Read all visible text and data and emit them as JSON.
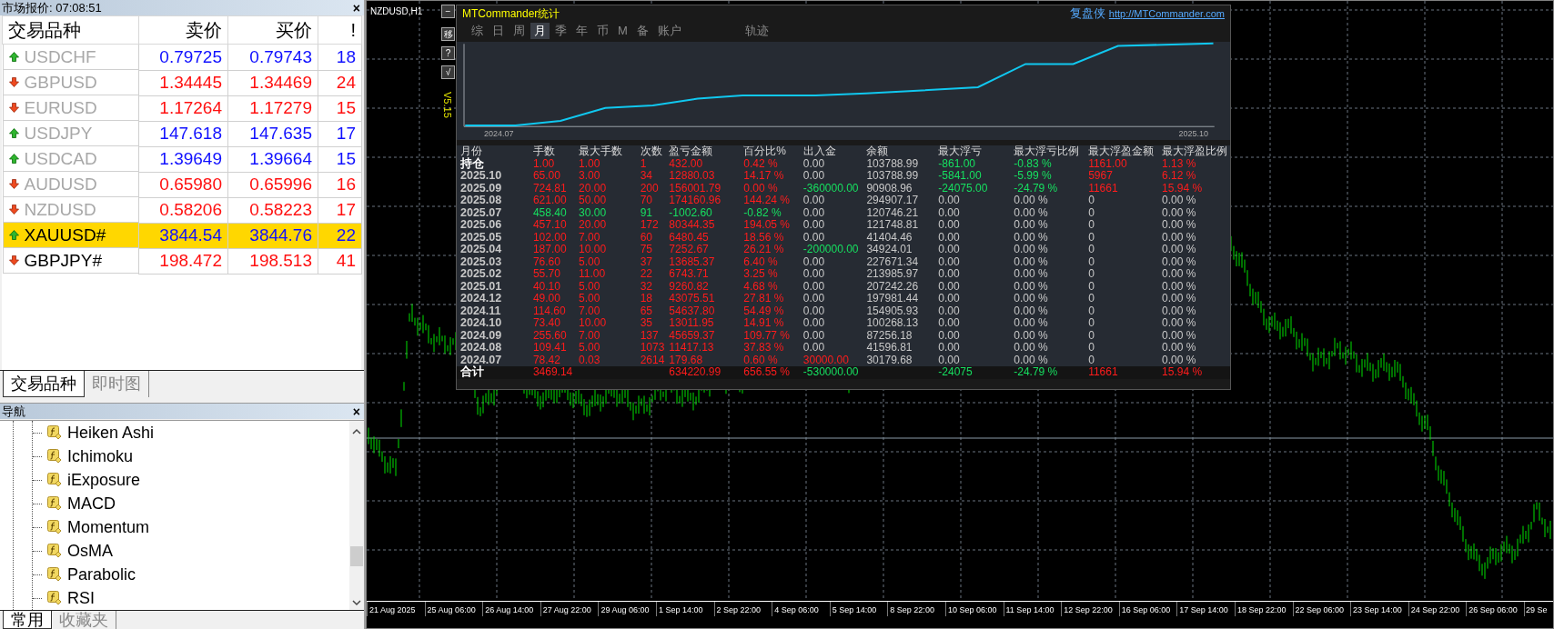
{
  "market_watch": {
    "title": "市场报价: 07:08:51",
    "close": "×",
    "columns": [
      "交易品种",
      "卖价",
      "买价",
      "!"
    ],
    "rows": [
      {
        "symbol": "USDCHF",
        "bid": "0.79725",
        "ask": "0.79743",
        "spread": "18",
        "rising": true,
        "dimmed": true,
        "selected": false
      },
      {
        "symbol": "GBPUSD",
        "bid": "1.34445",
        "ask": "1.34469",
        "spread": "24",
        "rising": false,
        "dimmed": true,
        "selected": false
      },
      {
        "symbol": "EURUSD",
        "bid": "1.17264",
        "ask": "1.17279",
        "spread": "15",
        "rising": false,
        "dimmed": true,
        "selected": false
      },
      {
        "symbol": "USDJPY",
        "bid": "147.618",
        "ask": "147.635",
        "spread": "17",
        "rising": true,
        "dimmed": true,
        "selected": false
      },
      {
        "symbol": "USDCAD",
        "bid": "1.39649",
        "ask": "1.39664",
        "spread": "15",
        "rising": true,
        "dimmed": true,
        "selected": false
      },
      {
        "symbol": "AUDUSD",
        "bid": "0.65980",
        "ask": "0.65996",
        "spread": "16",
        "rising": false,
        "dimmed": true,
        "selected": false
      },
      {
        "symbol": "NZDUSD",
        "bid": "0.58206",
        "ask": "0.58223",
        "spread": "17",
        "rising": false,
        "dimmed": true,
        "selected": false
      },
      {
        "symbol": "XAUUSD#",
        "bid": "3844.54",
        "ask": "3844.76",
        "spread": "22",
        "rising": true,
        "dimmed": false,
        "selected": true
      },
      {
        "symbol": "GBPJPY#",
        "bid": "198.472",
        "ask": "198.513",
        "spread": "41",
        "rising": false,
        "dimmed": false,
        "selected": false
      }
    ],
    "tabs": [
      {
        "label": "交易品种",
        "selected": true
      },
      {
        "label": "即时图",
        "selected": false
      }
    ]
  },
  "navigator": {
    "title": "导航",
    "close": "×",
    "items": [
      "Heiken Ashi",
      "Ichimoku",
      "iExposure",
      "MACD",
      "Momentum",
      "OsMA",
      "Parabolic",
      "RSI"
    ],
    "tabs": [
      {
        "label": "常用",
        "selected": true
      },
      {
        "label": "收藏夹",
        "selected": false
      }
    ]
  },
  "chart": {
    "title": "NZDUSD,H1",
    "time_labels": [
      "21 Aug 2025",
      "25 Aug 06:00",
      "26 Aug 14:00",
      "27 Aug 22:00",
      "29 Aug 06:00",
      "1 Sep 14:00",
      "2 Sep 22:00",
      "4 Sep 06:00",
      "5 Sep 14:00",
      "8 Sep 22:00",
      "10 Sep 06:00",
      "11 Sep 14:00",
      "12 Sep 22:00",
      "16 Sep 06:00",
      "17 Sep 14:00",
      "18 Sep 22:00",
      "22 Sep 06:00",
      "23 Sep 14:00",
      "24 Sep 22:00",
      "26 Sep 06:00",
      "29 Se"
    ]
  },
  "stats_panel": {
    "side_buttons": [
      "−",
      "移",
      "?",
      "√"
    ],
    "title": "MTCommander统计",
    "brand": "复盘侠",
    "url": "http://MTCommander.com",
    "tabs": [
      {
        "label": "综",
        "selected": false
      },
      {
        "label": "日",
        "selected": false
      },
      {
        "label": "周",
        "selected": false
      },
      {
        "label": "月",
        "selected": true
      },
      {
        "label": "季",
        "selected": false
      },
      {
        "label": "年",
        "selected": false
      },
      {
        "label": "币",
        "selected": false
      },
      {
        "label": "M",
        "selected": false
      },
      {
        "label": "备",
        "selected": false
      },
      {
        "label": "账户",
        "selected": false
      },
      {
        "label": "轨迹",
        "selected": false
      }
    ],
    "version": "V5.15",
    "curve_start": "2024.07",
    "curve_end": "2025.10",
    "columns": [
      "月份",
      "手数",
      "最大手数",
      "次数",
      "盈亏金额",
      "百分比%",
      "出入金",
      "余额",
      "最大浮亏",
      "最大浮亏比例",
      "最大浮盈金额",
      "最大浮盈比例"
    ],
    "rows": [
      [
        {
          "text": "持仓",
          "color": "#ffffff"
        },
        {
          "text": "1.00",
          "color": "#ff1c1c"
        },
        {
          "text": "1.00",
          "color": "#ff1c1c"
        },
        {
          "text": "1",
          "color": "#ff1c1c"
        },
        {
          "text": "432.00",
          "color": "#ff1c1c"
        },
        {
          "text": "0.42 %",
          "color": "#ff1c1c"
        },
        {
          "text": "0.00",
          "color": "#c8c8c8"
        },
        {
          "text": "103788.99",
          "color": "#c8c8c8"
        },
        {
          "text": "-861.00",
          "color": "#16e060"
        },
        {
          "text": "-0.83 %",
          "color": "#16e060"
        },
        {
          "text": "1161.00",
          "color": "#ff1c1c"
        },
        {
          "text": "1.13 %",
          "color": "#ff1c1c"
        }
      ],
      [
        {
          "text": "2025.10",
          "color": "#c8c8c8"
        },
        {
          "text": "65.00",
          "color": "#ff1c1c"
        },
        {
          "text": "3.00",
          "color": "#ff1c1c"
        },
        {
          "text": "34",
          "color": "#ff1c1c"
        },
        {
          "text": "12880.03",
          "color": "#ff1c1c"
        },
        {
          "text": "14.17 %",
          "color": "#ff1c1c"
        },
        {
          "text": "0.00",
          "color": "#c8c8c8"
        },
        {
          "text": "103788.99",
          "color": "#c8c8c8"
        },
        {
          "text": "-5841.00",
          "color": "#16e060"
        },
        {
          "text": "-5.99 %",
          "color": "#16e060"
        },
        {
          "text": "5967",
          "color": "#ff1c1c"
        },
        {
          "text": "6.12 %",
          "color": "#ff1c1c"
        }
      ],
      [
        {
          "text": "2025.09",
          "color": "#c8c8c8"
        },
        {
          "text": "724.81",
          "color": "#ff1c1c"
        },
        {
          "text": "20.00",
          "color": "#ff1c1c"
        },
        {
          "text": "200",
          "color": "#ff1c1c"
        },
        {
          "text": "156001.79",
          "color": "#ff1c1c"
        },
        {
          "text": "0.00 %",
          "color": "#ff1c1c"
        },
        {
          "text": "-360000.00",
          "color": "#16e060"
        },
        {
          "text": "90908.96",
          "color": "#c8c8c8"
        },
        {
          "text": "-24075.00",
          "color": "#16e060"
        },
        {
          "text": "-24.79 %",
          "color": "#16e060"
        },
        {
          "text": "11661",
          "color": "#ff1c1c"
        },
        {
          "text": "15.94 %",
          "color": "#ff1c1c"
        }
      ],
      [
        {
          "text": "2025.08",
          "color": "#c8c8c8"
        },
        {
          "text": "621.00",
          "color": "#ff1c1c"
        },
        {
          "text": "50.00",
          "color": "#ff1c1c"
        },
        {
          "text": "70",
          "color": "#ff1c1c"
        },
        {
          "text": "174160.96",
          "color": "#ff1c1c"
        },
        {
          "text": "144.24 %",
          "color": "#ff1c1c"
        },
        {
          "text": "0.00",
          "color": "#c8c8c8"
        },
        {
          "text": "294907.17",
          "color": "#c8c8c8"
        },
        {
          "text": "0.00",
          "color": "#c8c8c8"
        },
        {
          "text": "0.00 %",
          "color": "#c8c8c8"
        },
        {
          "text": "0",
          "color": "#c8c8c8"
        },
        {
          "text": "0.00 %",
          "color": "#c8c8c8"
        }
      ],
      [
        {
          "text": "2025.07",
          "color": "#c8c8c8"
        },
        {
          "text": "458.40",
          "color": "#16e060"
        },
        {
          "text": "30.00",
          "color": "#16e060"
        },
        {
          "text": "91",
          "color": "#16e060"
        },
        {
          "text": "-1002.60",
          "color": "#16e060"
        },
        {
          "text": "-0.82 %",
          "color": "#16e060"
        },
        {
          "text": "0.00",
          "color": "#c8c8c8"
        },
        {
          "text": "120746.21",
          "color": "#c8c8c8"
        },
        {
          "text": "0.00",
          "color": "#c8c8c8"
        },
        {
          "text": "0.00 %",
          "color": "#c8c8c8"
        },
        {
          "text": "0",
          "color": "#c8c8c8"
        },
        {
          "text": "0.00 %",
          "color": "#c8c8c8"
        }
      ],
      [
        {
          "text": "2025.06",
          "color": "#c8c8c8"
        },
        {
          "text": "457.10",
          "color": "#ff1c1c"
        },
        {
          "text": "20.00",
          "color": "#ff1c1c"
        },
        {
          "text": "172",
          "color": "#ff1c1c"
        },
        {
          "text": "80344.35",
          "color": "#ff1c1c"
        },
        {
          "text": "194.05 %",
          "color": "#ff1c1c"
        },
        {
          "text": "0.00",
          "color": "#c8c8c8"
        },
        {
          "text": "121748.81",
          "color": "#c8c8c8"
        },
        {
          "text": "0.00",
          "color": "#c8c8c8"
        },
        {
          "text": "0.00 %",
          "color": "#c8c8c8"
        },
        {
          "text": "0",
          "color": "#c8c8c8"
        },
        {
          "text": "0.00 %",
          "color": "#c8c8c8"
        }
      ],
      [
        {
          "text": "2025.05",
          "color": "#c8c8c8"
        },
        {
          "text": "102.00",
          "color": "#ff1c1c"
        },
        {
          "text": "7.00",
          "color": "#ff1c1c"
        },
        {
          "text": "60",
          "color": "#ff1c1c"
        },
        {
          "text": "6480.45",
          "color": "#ff1c1c"
        },
        {
          "text": "18.56 %",
          "color": "#ff1c1c"
        },
        {
          "text": "0.00",
          "color": "#c8c8c8"
        },
        {
          "text": "41404.46",
          "color": "#c8c8c8"
        },
        {
          "text": "0.00",
          "color": "#c8c8c8"
        },
        {
          "text": "0.00 %",
          "color": "#c8c8c8"
        },
        {
          "text": "0",
          "color": "#c8c8c8"
        },
        {
          "text": "0.00 %",
          "color": "#c8c8c8"
        }
      ],
      [
        {
          "text": "2025.04",
          "color": "#c8c8c8"
        },
        {
          "text": "187.00",
          "color": "#ff1c1c"
        },
        {
          "text": "10.00",
          "color": "#ff1c1c"
        },
        {
          "text": "75",
          "color": "#ff1c1c"
        },
        {
          "text": "7252.67",
          "color": "#ff1c1c"
        },
        {
          "text": "26.21 %",
          "color": "#ff1c1c"
        },
        {
          "text": "-200000.00",
          "color": "#16e060"
        },
        {
          "text": "34924.01",
          "color": "#c8c8c8"
        },
        {
          "text": "0.00",
          "color": "#c8c8c8"
        },
        {
          "text": "0.00 %",
          "color": "#c8c8c8"
        },
        {
          "text": "0",
          "color": "#c8c8c8"
        },
        {
          "text": "0.00 %",
          "color": "#c8c8c8"
        }
      ],
      [
        {
          "text": "2025.03",
          "color": "#c8c8c8"
        },
        {
          "text": "76.60",
          "color": "#ff1c1c"
        },
        {
          "text": "5.00",
          "color": "#ff1c1c"
        },
        {
          "text": "37",
          "color": "#ff1c1c"
        },
        {
          "text": "13685.37",
          "color": "#ff1c1c"
        },
        {
          "text": "6.40 %",
          "color": "#ff1c1c"
        },
        {
          "text": "0.00",
          "color": "#c8c8c8"
        },
        {
          "text": "227671.34",
          "color": "#c8c8c8"
        },
        {
          "text": "0.00",
          "color": "#c8c8c8"
        },
        {
          "text": "0.00 %",
          "color": "#c8c8c8"
        },
        {
          "text": "0",
          "color": "#c8c8c8"
        },
        {
          "text": "0.00 %",
          "color": "#c8c8c8"
        }
      ],
      [
        {
          "text": "2025.02",
          "color": "#c8c8c8"
        },
        {
          "text": "55.70",
          "color": "#ff1c1c"
        },
        {
          "text": "11.00",
          "color": "#ff1c1c"
        },
        {
          "text": "22",
          "color": "#ff1c1c"
        },
        {
          "text": "6743.71",
          "color": "#ff1c1c"
        },
        {
          "text": "3.25 %",
          "color": "#ff1c1c"
        },
        {
          "text": "0.00",
          "color": "#c8c8c8"
        },
        {
          "text": "213985.97",
          "color": "#c8c8c8"
        },
        {
          "text": "0.00",
          "color": "#c8c8c8"
        },
        {
          "text": "0.00 %",
          "color": "#c8c8c8"
        },
        {
          "text": "0",
          "color": "#c8c8c8"
        },
        {
          "text": "0.00 %",
          "color": "#c8c8c8"
        }
      ],
      [
        {
          "text": "2025.01",
          "color": "#c8c8c8"
        },
        {
          "text": "40.10",
          "color": "#ff1c1c"
        },
        {
          "text": "5.00",
          "color": "#ff1c1c"
        },
        {
          "text": "32",
          "color": "#ff1c1c"
        },
        {
          "text": "9260.82",
          "color": "#ff1c1c"
        },
        {
          "text": "4.68 %",
          "color": "#ff1c1c"
        },
        {
          "text": "0.00",
          "color": "#c8c8c8"
        },
        {
          "text": "207242.26",
          "color": "#c8c8c8"
        },
        {
          "text": "0.00",
          "color": "#c8c8c8"
        },
        {
          "text": "0.00 %",
          "color": "#c8c8c8"
        },
        {
          "text": "0",
          "color": "#c8c8c8"
        },
        {
          "text": "0.00 %",
          "color": "#c8c8c8"
        }
      ],
      [
        {
          "text": "2024.12",
          "color": "#c8c8c8"
        },
        {
          "text": "49.00",
          "color": "#ff1c1c"
        },
        {
          "text": "5.00",
          "color": "#ff1c1c"
        },
        {
          "text": "18",
          "color": "#ff1c1c"
        },
        {
          "text": "43075.51",
          "color": "#ff1c1c"
        },
        {
          "text": "27.81 %",
          "color": "#ff1c1c"
        },
        {
          "text": "0.00",
          "color": "#c8c8c8"
        },
        {
          "text": "197981.44",
          "color": "#c8c8c8"
        },
        {
          "text": "0.00",
          "color": "#c8c8c8"
        },
        {
          "text": "0.00 %",
          "color": "#c8c8c8"
        },
        {
          "text": "0",
          "color": "#c8c8c8"
        },
        {
          "text": "0.00 %",
          "color": "#c8c8c8"
        }
      ],
      [
        {
          "text": "2024.11",
          "color": "#c8c8c8"
        },
        {
          "text": "114.60",
          "color": "#ff1c1c"
        },
        {
          "text": "7.00",
          "color": "#ff1c1c"
        },
        {
          "text": "65",
          "color": "#ff1c1c"
        },
        {
          "text": "54637.80",
          "color": "#ff1c1c"
        },
        {
          "text": "54.49 %",
          "color": "#ff1c1c"
        },
        {
          "text": "0.00",
          "color": "#c8c8c8"
        },
        {
          "text": "154905.93",
          "color": "#c8c8c8"
        },
        {
          "text": "0.00",
          "color": "#c8c8c8"
        },
        {
          "text": "0.00 %",
          "color": "#c8c8c8"
        },
        {
          "text": "0",
          "color": "#c8c8c8"
        },
        {
          "text": "0.00 %",
          "color": "#c8c8c8"
        }
      ],
      [
        {
          "text": "2024.10",
          "color": "#c8c8c8"
        },
        {
          "text": "73.40",
          "color": "#ff1c1c"
        },
        {
          "text": "10.00",
          "color": "#ff1c1c"
        },
        {
          "text": "35",
          "color": "#ff1c1c"
        },
        {
          "text": "13011.95",
          "color": "#ff1c1c"
        },
        {
          "text": "14.91 %",
          "color": "#ff1c1c"
        },
        {
          "text": "0.00",
          "color": "#c8c8c8"
        },
        {
          "text": "100268.13",
          "color": "#c8c8c8"
        },
        {
          "text": "0.00",
          "color": "#c8c8c8"
        },
        {
          "text": "0.00 %",
          "color": "#c8c8c8"
        },
        {
          "text": "0",
          "color": "#c8c8c8"
        },
        {
          "text": "0.00 %",
          "color": "#c8c8c8"
        }
      ],
      [
        {
          "text": "2024.09",
          "color": "#c8c8c8"
        },
        {
          "text": "255.60",
          "color": "#ff1c1c"
        },
        {
          "text": "7.00",
          "color": "#ff1c1c"
        },
        {
          "text": "137",
          "color": "#ff1c1c"
        },
        {
          "text": "45659.37",
          "color": "#ff1c1c"
        },
        {
          "text": "109.77 %",
          "color": "#ff1c1c"
        },
        {
          "text": "0.00",
          "color": "#c8c8c8"
        },
        {
          "text": "87256.18",
          "color": "#c8c8c8"
        },
        {
          "text": "0.00",
          "color": "#c8c8c8"
        },
        {
          "text": "0.00 %",
          "color": "#c8c8c8"
        },
        {
          "text": "0",
          "color": "#c8c8c8"
        },
        {
          "text": "0.00 %",
          "color": "#c8c8c8"
        }
      ],
      [
        {
          "text": "2024.08",
          "color": "#c8c8c8"
        },
        {
          "text": "109.41",
          "color": "#ff1c1c"
        },
        {
          "text": "5.00",
          "color": "#ff1c1c"
        },
        {
          "text": "1073",
          "color": "#ff1c1c"
        },
        {
          "text": "11417.13",
          "color": "#ff1c1c"
        },
        {
          "text": "37.83 %",
          "color": "#ff1c1c"
        },
        {
          "text": "0.00",
          "color": "#c8c8c8"
        },
        {
          "text": "41596.81",
          "color": "#c8c8c8"
        },
        {
          "text": "0.00",
          "color": "#c8c8c8"
        },
        {
          "text": "0.00 %",
          "color": "#c8c8c8"
        },
        {
          "text": "0",
          "color": "#c8c8c8"
        },
        {
          "text": "0.00 %",
          "color": "#c8c8c8"
        }
      ],
      [
        {
          "text": "2024.07",
          "color": "#c8c8c8"
        },
        {
          "text": "78.42",
          "color": "#ff1c1c"
        },
        {
          "text": "0.03",
          "color": "#ff1c1c"
        },
        {
          "text": "2614",
          "color": "#ff1c1c"
        },
        {
          "text": "179.68",
          "color": "#ff1c1c"
        },
        {
          "text": "0.60 %",
          "color": "#ff1c1c"
        },
        {
          "text": "30000.00",
          "color": "#ff1c1c"
        },
        {
          "text": "30179.68",
          "color": "#c8c8c8"
        },
        {
          "text": "0.00",
          "color": "#c8c8c8"
        },
        {
          "text": "0.00 %",
          "color": "#c8c8c8"
        },
        {
          "text": "0",
          "color": "#c8c8c8"
        },
        {
          "text": "0.00 %",
          "color": "#c8c8c8"
        }
      ]
    ],
    "total": {
      "label": {
        "text": "合计",
        "color": "#ffffff"
      },
      "lots": {
        "text": "3469.14",
        "color": "#ff1c1c"
      },
      "pnl": {
        "text": "634220.99",
        "color": "#ff1c1c"
      },
      "pct": {
        "text": "656.55 %",
        "color": "#ff1c1c"
      },
      "flow": {
        "text": "-530000.00",
        "color": "#16e060"
      },
      "float_loss": {
        "text": "-24075",
        "color": "#16e060"
      },
      "float_loss_pct": {
        "text": "-24.79 %",
        "color": "#16e060"
      },
      "float_profit": {
        "text": "11661",
        "color": "#ff1c1c"
      },
      "float_profit_pct": {
        "text": "15.94 %",
        "color": "#ff1c1c"
      }
    }
  }
}
